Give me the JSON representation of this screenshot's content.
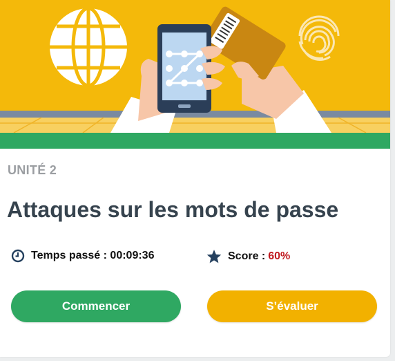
{
  "card": {
    "unit_label": "UNITÉ 2",
    "title": "Attaques sur les mots de passe",
    "time_label": "Temps passé : 00:09:36",
    "score_label": "Score :",
    "score_value": "60%",
    "start_button": "Commencer",
    "evaluate_button": "S’évaluer"
  },
  "icons": {
    "time": "clock-icon",
    "score": "star-icon"
  },
  "colors": {
    "hero_background": "#f4b90a",
    "hero_bar": "#2fa862",
    "title": "#36434e",
    "unit_label": "#9b9ea2",
    "score_value": "#c0191f",
    "start_button": "#2fa862",
    "evaluate_button": "#f2b100"
  }
}
